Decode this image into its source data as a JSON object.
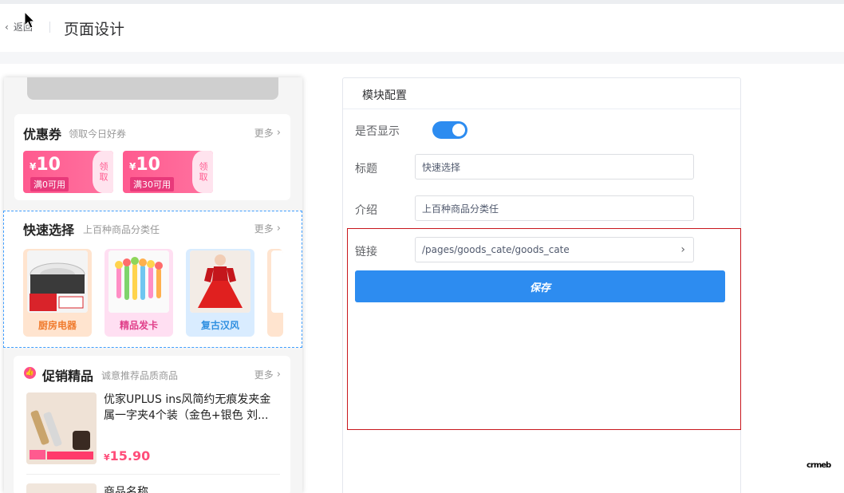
{
  "header": {
    "back_label": "返回",
    "title": "页面设计"
  },
  "preview": {
    "coupon_section": {
      "title": "优惠券",
      "subtitle": "领取今日好券",
      "more": "更多",
      "coupons": [
        {
          "currency": "¥",
          "amount": "10",
          "condition": "满0可用",
          "action": "领取"
        },
        {
          "currency": "¥",
          "amount": "10",
          "condition": "满30可用",
          "action": "领取"
        }
      ]
    },
    "quick_section": {
      "title": "快速选择",
      "subtitle": "上百种商品分类任",
      "more": "更多",
      "items": [
        {
          "label": "厨房电器",
          "color": "#f07b2e",
          "bg": "#ffe4cf"
        },
        {
          "label": "精品发卡",
          "color": "#e0408a",
          "bg": "#ffdff2"
        },
        {
          "label": "复古汉风",
          "color": "#2f8fe0",
          "bg": "#d9ecff"
        }
      ]
    },
    "promo_section": {
      "title": "促销精品",
      "subtitle": "诚意推荐品质商品",
      "more": "更多",
      "goods": [
        {
          "name": "优家UPLUS ins风简约无痕发夹金属一字夹4个装（金色+银色 刘...",
          "currency": "¥",
          "price": "15.90"
        },
        {
          "name": "商品名称"
        }
      ]
    }
  },
  "config": {
    "panel_title": "模块配置",
    "show_label": "是否显示",
    "show_enabled": true,
    "title_label": "标题",
    "title_value": "快速选择",
    "intro_label": "介绍",
    "intro_value": "上百种商品分类任",
    "link_label": "链接",
    "link_value": "/pages/goods_cate/goods_cate",
    "save_label": "保存"
  },
  "colors": {
    "primary": "#2d8cf0",
    "coupon": "#ff5a8f",
    "highlight": "#c8161d",
    "price": "#ff4d7a"
  },
  "watermark": "crmeb"
}
